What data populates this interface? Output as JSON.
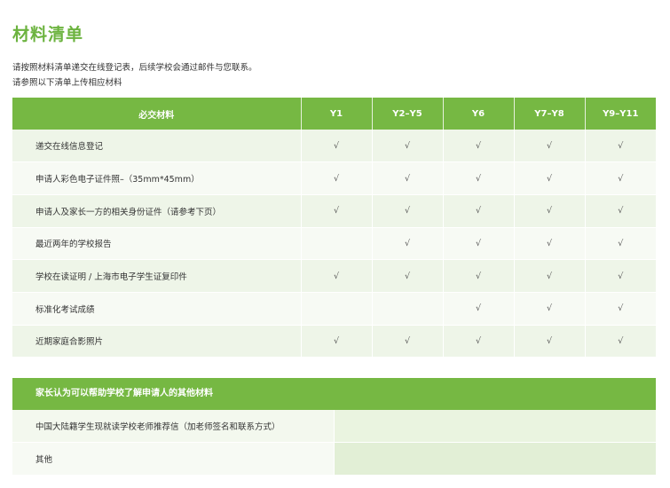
{
  "title": "材料清单",
  "intro": {
    "line1": "请按照材料清单递交在线登记表，后续学校会通过邮件与您联系。",
    "line2": "请参照以下清单上传相应材料"
  },
  "materials_table": {
    "headers": [
      "必交材料",
      "Y1",
      "Y2–Y5",
      "Y6",
      "Y7–Y8",
      "Y9–Y11"
    ],
    "rows": [
      {
        "item": "递交在线信息登记",
        "checks": [
          "√",
          "√",
          "√",
          "√",
          "√"
        ]
      },
      {
        "item": "申请人彩色电子证件照–（35mm*45mm）",
        "checks": [
          "√",
          "√",
          "√",
          "√",
          "√"
        ]
      },
      {
        "item": "申请人及家长一方的相关身份证件（请参考下页）",
        "checks": [
          "√",
          "√",
          "√",
          "√",
          "√"
        ]
      },
      {
        "item": "最近两年的学校报告",
        "checks": [
          "",
          "√",
          "√",
          "√",
          "√"
        ]
      },
      {
        "item": "学校在读证明 / 上海市电子学生证复印件",
        "checks": [
          "√",
          "√",
          "√",
          "√",
          "√"
        ]
      },
      {
        "item": "标准化考试成绩",
        "checks": [
          "",
          "",
          "√",
          "√",
          "√"
        ]
      },
      {
        "item": "近期家庭合影照片",
        "checks": [
          "√",
          "√",
          "√",
          "√",
          "√"
        ]
      }
    ]
  },
  "extra_section": {
    "header": "家长认为可以帮助学校了解申请人的其他材料",
    "rows": [
      {
        "item": "中国大陆籍学生现就读学校老师推荐信（加老师签名和联系方式）"
      },
      {
        "item": "其他"
      }
    ]
  },
  "colors": {
    "accent_green": "#76b843",
    "title_green": "#6cb33f",
    "row_light": "#eef5e8",
    "row_lighter": "#f7faf4"
  }
}
